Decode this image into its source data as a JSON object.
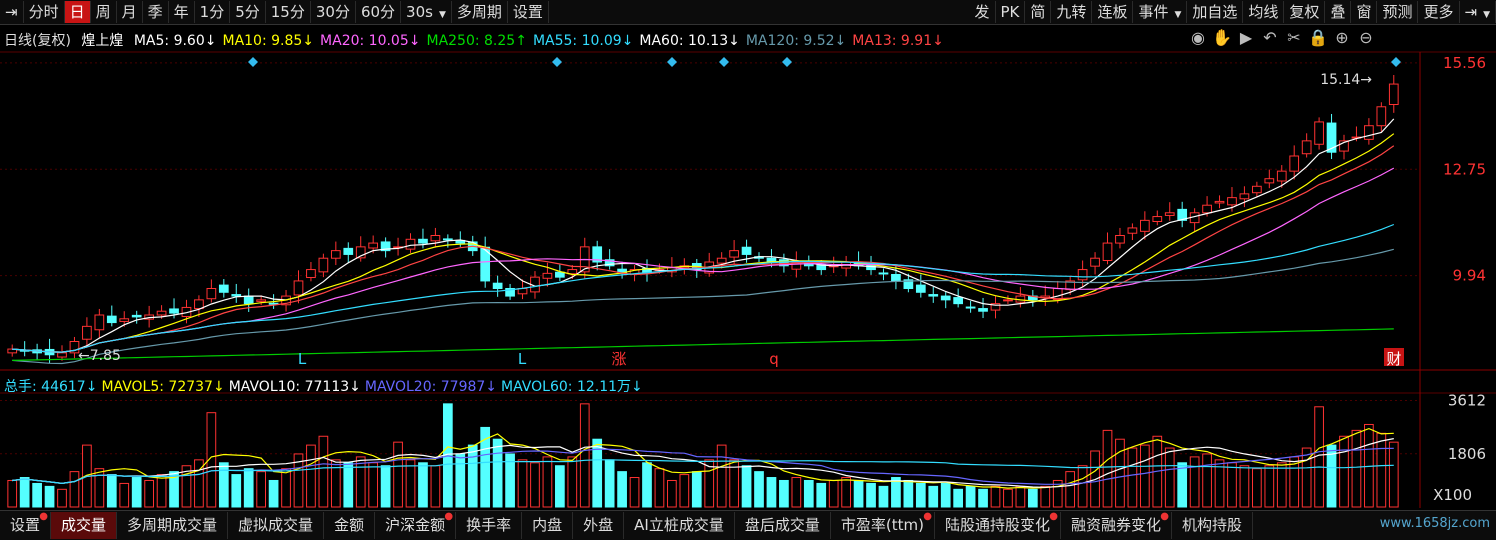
{
  "toolbar": {
    "left_items": [
      {
        "label": "⇥",
        "active": false
      },
      {
        "label": "分时",
        "active": false
      },
      {
        "label": "日",
        "active": true
      },
      {
        "label": "周",
        "active": false
      },
      {
        "label": "月",
        "active": false
      },
      {
        "label": "季",
        "active": false
      },
      {
        "label": "年",
        "active": false
      },
      {
        "label": "1分",
        "active": false
      },
      {
        "label": "5分",
        "active": false
      },
      {
        "label": "15分",
        "active": false
      },
      {
        "label": "30分",
        "active": false
      },
      {
        "label": "60分",
        "active": false
      },
      {
        "label": "30s",
        "active": false,
        "dropdown": true
      },
      {
        "label": "多周期",
        "active": false
      },
      {
        "label": "设置",
        "active": false
      }
    ],
    "right_items": [
      {
        "label": "发"
      },
      {
        "label": "PK"
      },
      {
        "label": "简"
      },
      {
        "label": "九转"
      },
      {
        "label": "连板"
      },
      {
        "label": "事件",
        "dropdown": true
      },
      {
        "label": "加自选"
      },
      {
        "label": "均线"
      },
      {
        "label": "复权"
      },
      {
        "label": "叠"
      },
      {
        "label": "窗"
      },
      {
        "label": "预测"
      },
      {
        "label": "更多"
      },
      {
        "label": "⇥",
        "dropdown": true
      }
    ]
  },
  "price_legend": {
    "period": "日线(复权)",
    "stock": "煌上煌",
    "items": [
      {
        "text": "MA5: 9.60↓",
        "color": "#ffffff"
      },
      {
        "text": "MA10: 9.85↓",
        "color": "#ffff00"
      },
      {
        "text": "MA20: 10.05↓",
        "color": "#ff66ff"
      },
      {
        "text": "MA250: 8.25↑",
        "color": "#00dd00"
      },
      {
        "text": "MA55: 10.09↓",
        "color": "#33ddff"
      },
      {
        "text": "MA60: 10.13↓",
        "color": "#ffffff"
      },
      {
        "text": "MA120: 9.52↓",
        "color": "#6699aa"
      },
      {
        "text": "MA13: 9.91↓",
        "color": "#ff4444"
      }
    ]
  },
  "tools": [
    "eye-icon",
    "hand-icon",
    "play-icon",
    "undo-icon",
    "scissors-icon",
    "lock-icon",
    "zoom-in-icon",
    "zoom-out-icon"
  ],
  "price_axis": {
    "labels": [
      "15.56",
      "12.75",
      "9.94"
    ],
    "low_mark": "7.85",
    "high_mark": "15.14"
  },
  "markers": [
    {
      "label": "L",
      "color": "#33ddff"
    },
    {
      "label": "L",
      "color": "#33ddff"
    },
    {
      "label": "涨",
      "color": "#ff3333"
    },
    {
      "label": "q",
      "color": "#ff3333"
    },
    {
      "label": "财",
      "color": "#ffffff"
    }
  ],
  "volume_legend": {
    "items": [
      {
        "text": "总手: 44617↓",
        "color": "#33ddff"
      },
      {
        "text": "MAVOL5: 72737↓",
        "color": "#ffff00"
      },
      {
        "text": "MAVOL10: 77113↓",
        "color": "#ffffff"
      },
      {
        "text": "MAVOL20: 77987↓",
        "color": "#6666ff"
      },
      {
        "text": "MAVOL60: 12.11万↓",
        "color": "#33ddff"
      }
    ]
  },
  "volume_axis": {
    "labels": [
      "3612",
      "1806"
    ],
    "unit": "X100"
  },
  "bottom_tabs": [
    {
      "label": "设置",
      "dot": true,
      "active": false
    },
    {
      "label": "成交量",
      "dot": false,
      "active": true
    },
    {
      "label": "多周期成交量",
      "dot": false,
      "active": false
    },
    {
      "label": "虚拟成交量",
      "dot": false,
      "active": false
    },
    {
      "label": "金额",
      "dot": false,
      "active": false
    },
    {
      "label": "沪深金额",
      "dot": true,
      "active": false
    },
    {
      "label": "换手率",
      "dot": false,
      "active": false
    },
    {
      "label": "内盘",
      "dot": false,
      "active": false
    },
    {
      "label": "外盘",
      "dot": false,
      "active": false
    },
    {
      "label": "AI立桩成交量",
      "dot": false,
      "active": false
    },
    {
      "label": "盘后成交量",
      "dot": false,
      "active": false
    },
    {
      "label": "市盈率(ttm)",
      "dot": true,
      "active": false
    },
    {
      "label": "陆股通持股变化",
      "dot": true,
      "active": false
    },
    {
      "label": "融资融券变化",
      "dot": true,
      "active": false
    },
    {
      "label": "机构持股",
      "dot": false,
      "active": false
    }
  ],
  "watermark": "www.1658jz.com",
  "chart_data": {
    "type": "candlestick",
    "title": "煌上煌 日线(复权)",
    "ylim": [
      7.5,
      15.9
    ],
    "volume_ylim": [
      0,
      3800
    ],
    "closes": [
      8.0,
      7.95,
      7.9,
      7.85,
      7.9,
      8.2,
      8.6,
      8.9,
      8.7,
      8.8,
      8.85,
      8.9,
      9.0,
      8.95,
      9.1,
      9.3,
      9.6,
      9.5,
      9.4,
      9.2,
      9.3,
      9.2,
      9.4,
      9.8,
      10.1,
      10.4,
      10.6,
      10.5,
      10.7,
      10.8,
      10.6,
      10.7,
      10.9,
      10.8,
      11.0,
      10.9,
      10.8,
      10.6,
      9.8,
      9.6,
      9.4,
      9.6,
      9.9,
      10.0,
      9.9,
      10.1,
      10.7,
      10.3,
      10.2,
      10.0,
      10.1,
      10.0,
      10.1,
      10.15,
      10.2,
      10.1,
      10.3,
      10.4,
      10.6,
      10.5,
      10.4,
      10.3,
      10.2,
      10.3,
      10.2,
      10.1,
      10.2,
      10.3,
      10.2,
      10.1,
      10.0,
      9.8,
      9.6,
      9.5,
      9.4,
      9.3,
      9.2,
      9.1,
      9.0,
      9.2,
      9.3,
      9.4,
      9.3,
      9.4,
      9.6,
      9.8,
      10.1,
      10.4,
      10.8,
      11.0,
      11.2,
      11.4,
      11.5,
      11.6,
      11.4,
      11.6,
      11.8,
      11.9,
      12.0,
      12.1,
      12.3,
      12.5,
      12.7,
      13.1,
      13.5,
      14.0,
      13.2,
      13.5,
      13.6,
      13.9,
      14.4,
      15.0
    ],
    "volumes": [
      900,
      1000,
      800,
      700,
      600,
      1200,
      2100,
      1300,
      1100,
      800,
      1000,
      900,
      1100,
      1200,
      1400,
      1600,
      3200,
      1500,
      1100,
      1300,
      1200,
      900,
      1300,
      1800,
      2100,
      2400,
      1600,
      1500,
      1700,
      1500,
      1400,
      2200,
      1600,
      1500,
      1400,
      3500,
      1800,
      2100,
      2700,
      2300,
      1800,
      1600,
      1500,
      1700,
      1400,
      1700,
      3500,
      2300,
      1600,
      1200,
      1000,
      1500,
      1300,
      900,
      1100,
      1200,
      1600,
      2100,
      1600,
      1400,
      1200,
      1000,
      900,
      1000,
      900,
      800,
      900,
      1000,
      900,
      800,
      700,
      1000,
      900,
      800,
      700,
      800,
      600,
      700,
      600,
      700,
      600,
      700,
      600,
      700,
      900,
      1200,
      1400,
      1900,
      2600,
      2300,
      2000,
      2100,
      2400,
      2000,
      1500,
      1700,
      1800,
      1600,
      1500,
      1400,
      1300,
      1400,
      1500,
      1700,
      2000,
      3400,
      2100,
      2400,
      2600,
      2800,
      2500,
      2200
    ]
  }
}
